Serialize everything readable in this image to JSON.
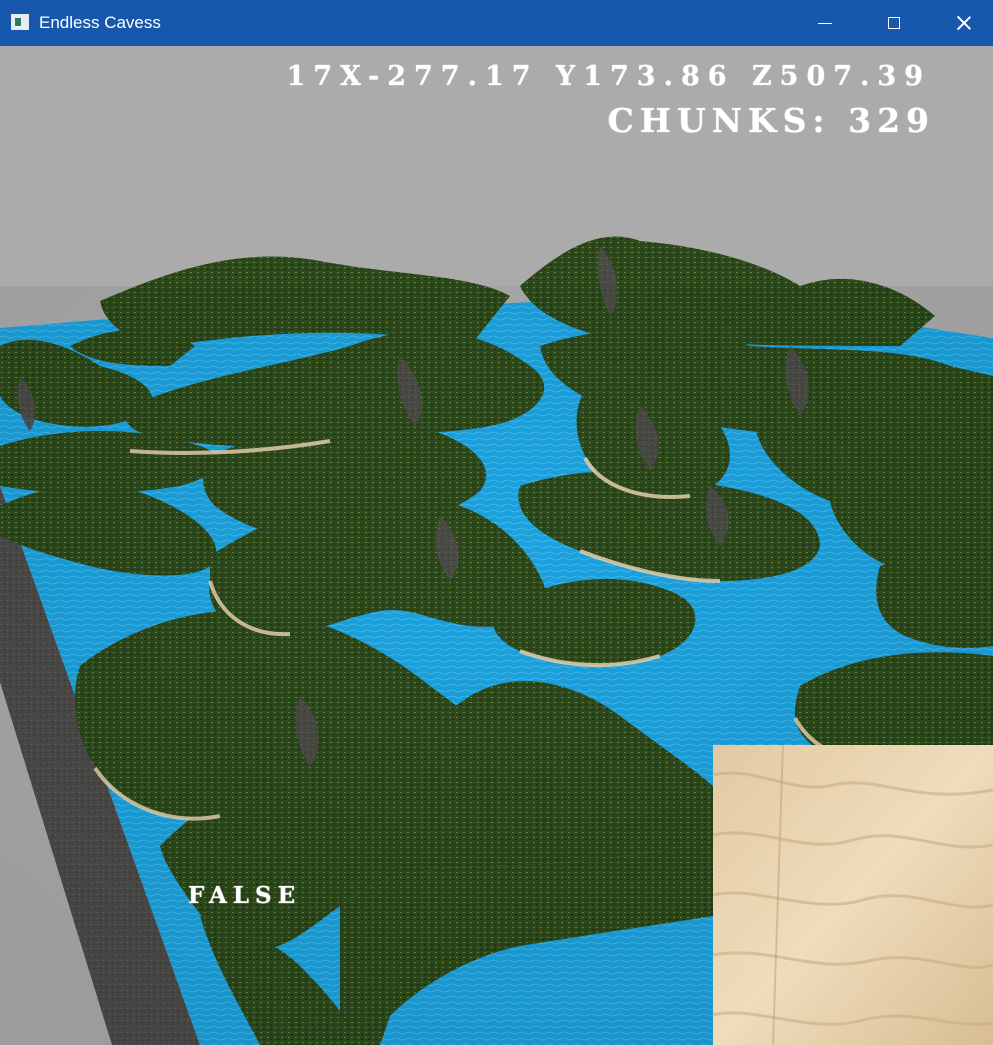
{
  "window": {
    "title": "Endless Cavess",
    "app_icon": "window-app-icon",
    "controls": [
      "minimize-icon",
      "maximize-icon",
      "close-icon"
    ]
  },
  "hud": {
    "position": "17X-277.17 Y173.86 Z507.39",
    "chunks": "CHUNKS: 329",
    "status": "FALSE"
  },
  "colors": {
    "titlebar": "#1758ad",
    "sky": "#ababab",
    "water": "#1aa1dd",
    "grass": "#2f4d1e",
    "stone": "#5a5856",
    "sand": "#e8d1ad"
  }
}
